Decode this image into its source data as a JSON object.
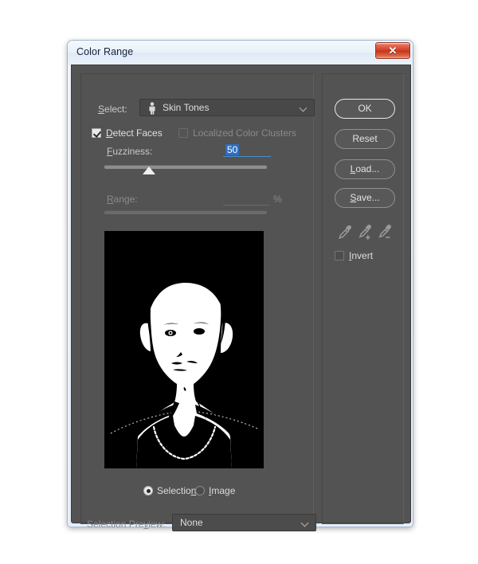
{
  "window": {
    "title": "Color Range",
    "close_label": "✕",
    "close_icon": "close-icon"
  },
  "select_row": {
    "label": "Select:",
    "value": "Skin Tones",
    "icon": "person-icon",
    "chevron": "chevron-down-icon"
  },
  "checkboxes": {
    "detect_faces": {
      "label": "Detect Faces",
      "checked": true,
      "enabled": true
    },
    "localized_color_clusters": {
      "label": "Localized Color Clusters",
      "checked": false,
      "enabled": false
    },
    "invert": {
      "label": "Invert",
      "checked": false,
      "enabled": true
    }
  },
  "fuzziness": {
    "label": "Fuzziness:",
    "value": "50",
    "selected": true,
    "slider_percent": 25
  },
  "range": {
    "label": "Range:",
    "value": "",
    "unit": "%",
    "enabled": false
  },
  "preview": {
    "mode": "mask",
    "description": "black and white selection mask of a person's head and shoulders"
  },
  "preview_mode": {
    "selection": {
      "label": "Selection",
      "selected": true
    },
    "image": {
      "label": "Image",
      "selected": false
    }
  },
  "selection_preview": {
    "label": "Selection Preview:",
    "value": "None",
    "chevron": "chevron-down-icon"
  },
  "buttons": {
    "ok": "OK",
    "reset": "Reset",
    "load": "Load...",
    "save": "Save..."
  },
  "eyedroppers": [
    {
      "name": "eyedropper-sample",
      "label": ""
    },
    {
      "name": "eyedropper-add",
      "label": "+"
    },
    {
      "name": "eyedropper-subtract",
      "label": "−"
    }
  ],
  "colors": {
    "panel_bg": "#535353",
    "titlebar_top": "#f3f8fd",
    "accent_selection": "#2f6ebf",
    "close_red": "#cf3d26",
    "text": "#c9c9c9",
    "text_disabled": "#8a8a8a"
  }
}
